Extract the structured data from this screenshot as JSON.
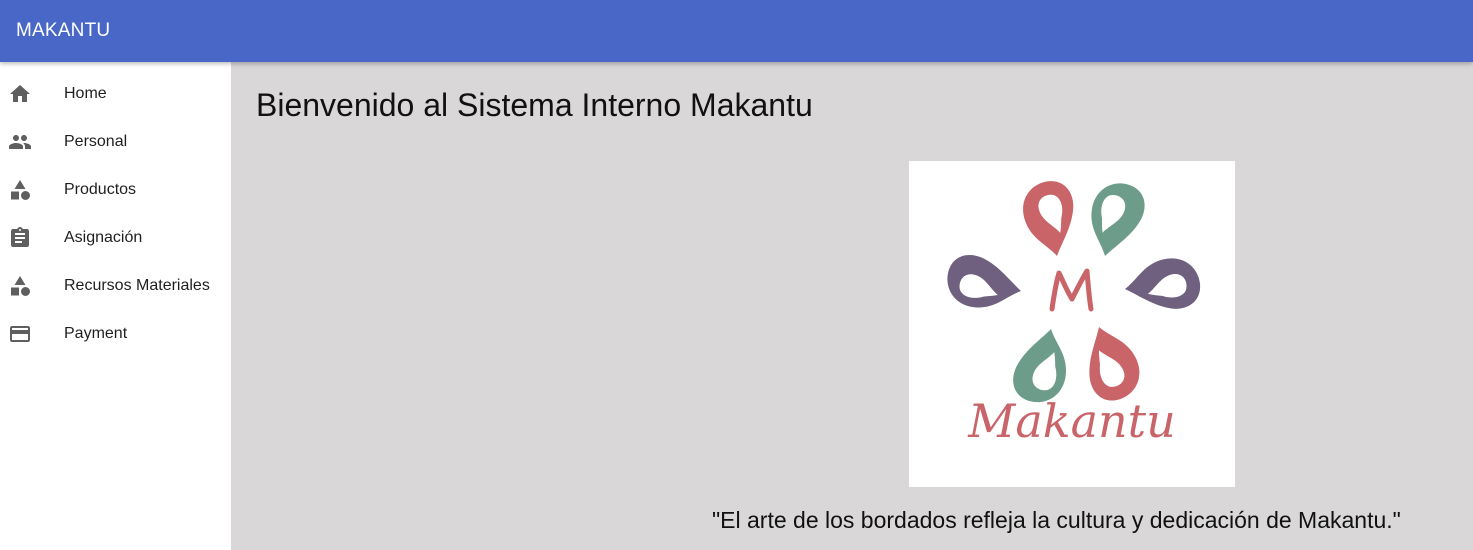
{
  "appbar": {
    "title": "MAKANTU",
    "color": "#4867c6"
  },
  "sidebar": {
    "items": [
      {
        "label": "Home",
        "icon": "home-icon"
      },
      {
        "label": "Personal",
        "icon": "people-icon"
      },
      {
        "label": "Productos",
        "icon": "category-icon"
      },
      {
        "label": "Asignación",
        "icon": "assignment-icon"
      },
      {
        "label": "Recursos Materiales",
        "icon": "category-icon"
      },
      {
        "label": "Payment",
        "icon": "credit-card-icon"
      }
    ]
  },
  "main": {
    "title": "Bienvenido al Sistema Interno Makantu",
    "logo": {
      "wordmark": "Makantu",
      "letter": "M",
      "colors": {
        "red": "#c96469",
        "green": "#6e9c8b",
        "purple": "#6f607f"
      }
    },
    "tagline": "\"El arte de los bordados refleja la cultura y dedicación de Makantu.\""
  }
}
